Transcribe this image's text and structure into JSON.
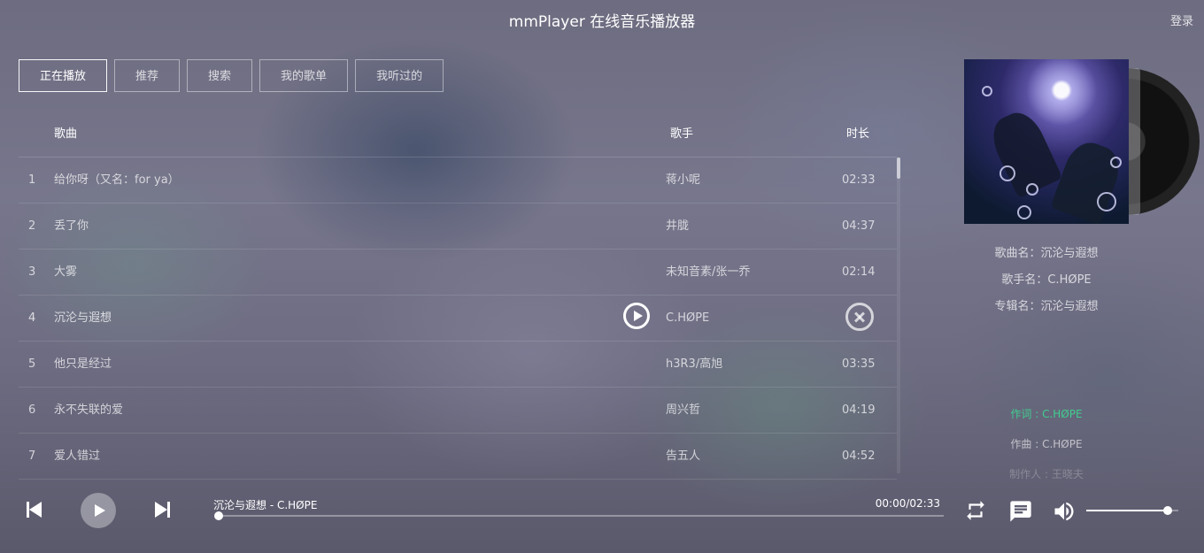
{
  "header": {
    "title": "mmPlayer 在线音乐播放器",
    "login": "登录"
  },
  "tabs": [
    {
      "label": "正在播放",
      "active": true
    },
    {
      "label": "推荐",
      "active": false
    },
    {
      "label": "搜索",
      "active": false
    },
    {
      "label": "我的歌单",
      "active": false
    },
    {
      "label": "我听过的",
      "active": false
    }
  ],
  "list": {
    "columns": {
      "name": "歌曲",
      "singer": "歌手",
      "duration": "时长"
    },
    "rows": [
      {
        "index": "1",
        "name": "给你呀（又名：for ya）",
        "singer": "蒋小呢",
        "duration": "02:33"
      },
      {
        "index": "2",
        "name": "丢了你",
        "singer": "井胧",
        "duration": "04:37"
      },
      {
        "index": "3",
        "name": "大雾",
        "singer": "未知音素/张一乔",
        "duration": "02:14"
      },
      {
        "index": "4",
        "name": "沉沦与遐想",
        "singer": "C.HØPE",
        "duration": "",
        "hover": true
      },
      {
        "index": "5",
        "name": "他只是经过",
        "singer": "h3R3/高旭",
        "duration": "03:35"
      },
      {
        "index": "6",
        "name": "永不失联的爱",
        "singer": "周兴哲",
        "duration": "04:19"
      },
      {
        "index": "7",
        "name": "爱人错过",
        "singer": "告五人",
        "duration": "04:52"
      }
    ],
    "scroll_position": 0.0
  },
  "info": {
    "song": "歌曲名：沉沦与遐想",
    "singer": "歌手名：C.HØPE",
    "album": "专辑名：沉沦与遐想"
  },
  "lyrics": {
    "line1": "作词 : C.HØPE",
    "line2": "作曲 : C.HØPE",
    "line3": "制作人 : 王晓夫"
  },
  "player": {
    "now_playing": "沉沦与遐想 - C.HØPE",
    "time": "00:00/02:33",
    "progress": 0.0,
    "volume": 0.88
  },
  "colors": {
    "accent_lyric": "#40ce8f"
  },
  "icons": {
    "prev": "skip-previous-icon",
    "play": "play-icon",
    "next": "skip-next-icon",
    "loop": "repeat-icon",
    "comment": "comment-icon",
    "volume": "volume-icon",
    "row_play": "play-circle-icon",
    "row_delete": "close-circle-icon"
  }
}
